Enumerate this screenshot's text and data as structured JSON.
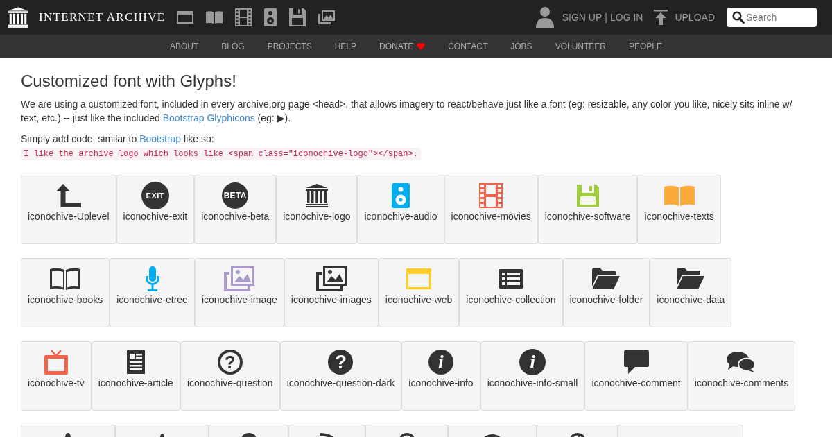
{
  "header": {
    "logo_text": "INTERNET ARCHIVE",
    "sign_up": "SIGN UP",
    "separator": "|",
    "log_in": "LOG IN",
    "upload": "UPLOAD",
    "search": {
      "placeholder": "Search"
    }
  },
  "nav": [
    {
      "label": "ABOUT",
      "kind": "plain"
    },
    {
      "label": "BLOG",
      "kind": "plain"
    },
    {
      "label": "PROJECTS",
      "kind": "plain"
    },
    {
      "label": "HELP",
      "kind": "plain"
    },
    {
      "label": "DONATE",
      "kind": "heart"
    },
    {
      "label": "CONTACT",
      "kind": "plain"
    },
    {
      "label": "JOBS",
      "kind": "plain"
    },
    {
      "label": "VOLUNTEER",
      "kind": "plain"
    },
    {
      "label": "PEOPLE",
      "kind": "plain"
    }
  ],
  "page": {
    "title": "Customized font with Glyphs!",
    "intro": {
      "text": "We are using a customized font, included in every archive.org page <head>, that allows imagery to react/behave just like a font (eg: resizable, any color you like, nicely sits inline w/ text, etc.) -- just like the included ",
      "link": "Bootstrap Glyphicons",
      "after": " (eg: ▶)."
    },
    "usage": {
      "text": "Simply add code, similar to ",
      "link": "Bootstrap",
      "after": " like so:"
    },
    "code": "I like the archive logo which looks like <span class=\"iconochive-logo\"></span>."
  },
  "icon_rows": [
    {
      "tiles": [
        {
          "kind": "full",
          "label": "iconochive-Uplevel",
          "color": "#333333"
        },
        {
          "kind": "full",
          "label": "iconochive-exit",
          "color": "#333333",
          "glyph_text": "EXIT"
        },
        {
          "kind": "full",
          "label": "iconochive-beta",
          "color": "#333333",
          "glyph_text": "BETA"
        },
        {
          "kind": "full",
          "label": "iconochive-logo",
          "color": "#333333"
        },
        {
          "kind": "full",
          "label": "iconochive-audio",
          "color": "#00adef"
        },
        {
          "kind": "full",
          "label": "iconochive-movies",
          "color": "#f1644b"
        },
        {
          "kind": "full",
          "label": "iconochive-software",
          "color": "#9ecc3b"
        },
        {
          "kind": "full",
          "label": "iconochive-texts",
          "color": "#faab3c"
        }
      ]
    },
    {
      "tiles": [
        {
          "kind": "full",
          "label": "iconochive-books",
          "color": "#333333"
        },
        {
          "kind": "full",
          "label": "iconochive-etree",
          "color": "#00adef"
        },
        {
          "kind": "full",
          "label": "iconochive-image",
          "color": "#aa99c9"
        },
        {
          "kind": "full",
          "label": "iconochive-images",
          "color": "#333333"
        },
        {
          "kind": "full",
          "label": "iconochive-web",
          "color": "#ffcd27"
        },
        {
          "kind": "full",
          "label": "iconochive-collection",
          "color": "#333333"
        },
        {
          "kind": "full",
          "label": "iconochive-folder",
          "color": "#333333"
        },
        {
          "kind": "full",
          "label": "iconochive-data",
          "color": "#333333"
        }
      ]
    },
    {
      "tiles": [
        {
          "kind": "full",
          "label": "iconochive-tv",
          "color": "#f1644b"
        },
        {
          "kind": "full",
          "label": "iconochive-article",
          "color": "#333333"
        },
        {
          "kind": "full",
          "label": "iconochive-question",
          "color": "#333333",
          "glyph_text": "?"
        },
        {
          "kind": "full",
          "label": "iconochive-question-dark",
          "color": "#333333",
          "glyph_text": "?"
        },
        {
          "kind": "full",
          "label": "iconochive-info",
          "color": "#333333",
          "glyph_text": "i"
        },
        {
          "kind": "full",
          "label": "iconochive-info-small",
          "color": "#333333",
          "glyph_text": "i"
        },
        {
          "kind": "full",
          "label": "iconochive-comment",
          "color": "#333333"
        },
        {
          "kind": "full",
          "label": "iconochive-comments",
          "color": "#333333"
        }
      ]
    },
    {
      "tiles": [
        {
          "kind": "cut",
          "color": "#333333"
        },
        {
          "kind": "cut",
          "color": "#333333"
        },
        {
          "kind": "cut",
          "color": "#333333"
        },
        {
          "kind": "cut",
          "color": "#333333"
        },
        {
          "kind": "cut",
          "color": "#333333"
        },
        {
          "kind": "cut",
          "color": "#333333"
        },
        {
          "kind": "cut",
          "color": "#333333"
        },
        {
          "kind": "cut"
        }
      ]
    }
  ]
}
